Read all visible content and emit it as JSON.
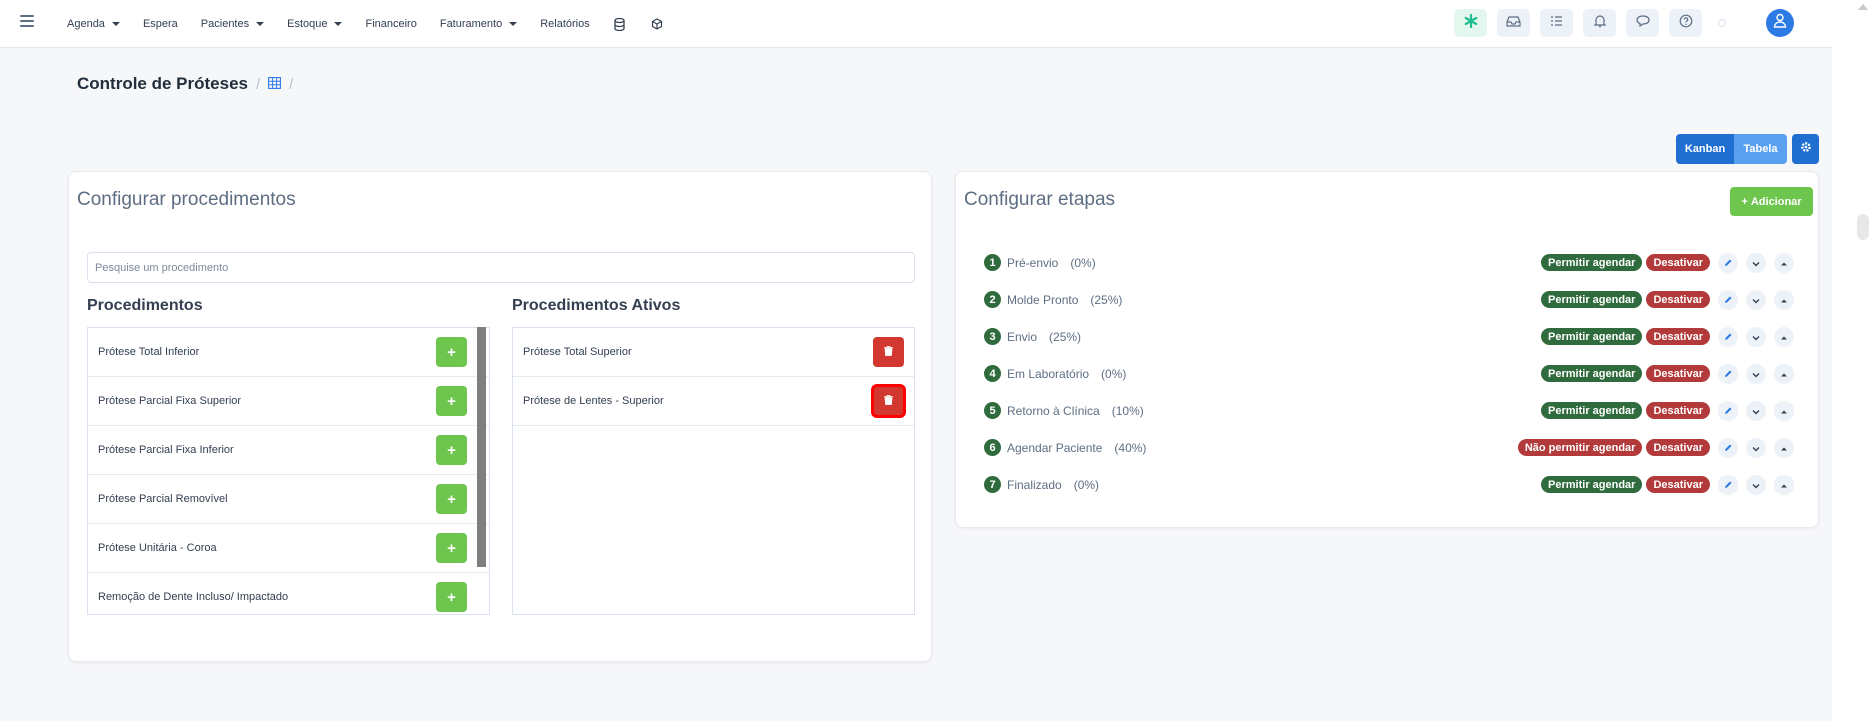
{
  "colors": {
    "primary": "#1f6fd1",
    "success": "#6fc64e",
    "danger": "#d2382f",
    "badge_green": "#2f6b3c",
    "badge_red": "#b23a3a"
  },
  "nav": {
    "items": [
      {
        "label": "Agenda",
        "dropdown": true
      },
      {
        "label": "Espera",
        "dropdown": false
      },
      {
        "label": "Pacientes",
        "dropdown": true
      },
      {
        "label": "Estoque",
        "dropdown": true
      },
      {
        "label": "Financeiro",
        "dropdown": false
      },
      {
        "label": "Faturamento",
        "dropdown": true
      },
      {
        "label": "Relatórios",
        "dropdown": false
      }
    ],
    "icons": [
      "database-icon",
      "cube-icon"
    ],
    "actions": [
      "star-icon",
      "inbox-icon",
      "checklist-icon",
      "bell-icon",
      "chat-icon",
      "help-icon"
    ]
  },
  "breadcrumb": {
    "title": "Controle de Próteses",
    "sep": "/"
  },
  "view_switch": {
    "kanban": "Kanban",
    "tabela": "Tabela"
  },
  "procedures": {
    "title": "Configurar procedimentos",
    "search_placeholder": "Pesquise um procedimento",
    "list_title": "Procedimentos",
    "active_title": "Procedimentos Ativos",
    "items": [
      "Prótese Total Inferior",
      "Prótese Parcial Fixa Superior",
      "Prótese Parcial Fixa Inferior",
      "Prótese Parcial Removível",
      "Prótese Unitária - Coroa",
      "Remoção de Dente Incluso/ Impactado"
    ],
    "active_items": [
      "Prótese Total Superior",
      "Prótese de Lentes - Superior"
    ],
    "add_symbol": "+"
  },
  "stages": {
    "title": "Configurar etapas",
    "add_label": "Adicionar",
    "add_symbol": "+",
    "items": [
      {
        "num": "1",
        "name": "Pré-envio",
        "pct": "(0%)",
        "permit": "Permitir agendar",
        "permit_type": "green",
        "deactivate": "Desativar"
      },
      {
        "num": "2",
        "name": "Molde Pronto",
        "pct": "(25%)",
        "permit": "Permitir agendar",
        "permit_type": "green",
        "deactivate": "Desativar"
      },
      {
        "num": "3",
        "name": "Envio",
        "pct": "(25%)",
        "permit": "Permitir agendar",
        "permit_type": "green",
        "deactivate": "Desativar"
      },
      {
        "num": "4",
        "name": "Em Laboratório",
        "pct": "(0%)",
        "permit": "Permitir agendar",
        "permit_type": "green",
        "deactivate": "Desativar"
      },
      {
        "num": "5",
        "name": "Retorno à Clínica",
        "pct": "(10%)",
        "permit": "Permitir agendar",
        "permit_type": "green",
        "deactivate": "Desativar"
      },
      {
        "num": "6",
        "name": "Agendar Paciente",
        "pct": "(40%)",
        "permit": "Não permitir agendar",
        "permit_type": "red",
        "deactivate": "Desativar"
      },
      {
        "num": "7",
        "name": "Finalizado",
        "pct": "(0%)",
        "permit": "Permitir agendar",
        "permit_type": "green",
        "deactivate": "Desativar"
      }
    ]
  }
}
